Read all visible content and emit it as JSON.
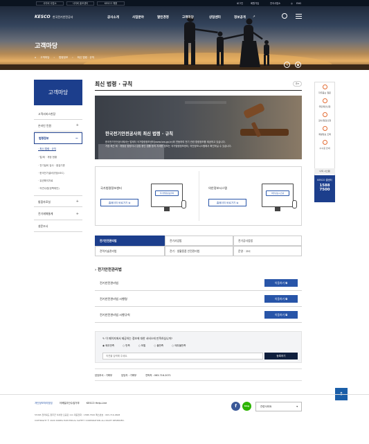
{
  "topbar": {
    "tabs": [
      "사이버 사업소",
      "사이버 홍보센터",
      "KESCO 채용"
    ],
    "links": [
      "로그인",
      "회원가입",
      "전국사업소",
      "ENG"
    ]
  },
  "header": {
    "logo_text": "KESCO",
    "logo_sub": "한국전기안전공사",
    "nav": [
      "공사소개",
      "사업분야",
      "열린경영",
      "고객마당",
      "상담센터",
      "정보공개"
    ],
    "hero_title": "고객마당",
    "breadcrumb": [
      "고객마당",
      "법령정보",
      "최신 법령 · 규칙"
    ]
  },
  "sidebar": {
    "title": "고객마당",
    "items": [
      {
        "label": "고객서비스헌장",
        "plus": false
      },
      {
        "label": "온라인 민원",
        "plus": true
      },
      {
        "label": "법령정보",
        "plus": false,
        "active": true
      },
      {
        "label": "통합자료실",
        "plus": true
      },
      {
        "label": "전기재해통계",
        "plus": true
      },
      {
        "label": "설문조사",
        "plus": false
      }
    ],
    "subitems": [
      "· 최신 법령 · 규칙",
      "· 법/제 · 개정 현황",
      "· 전기설비 검사 · 점검기준",
      "· 한국전기설비규정(KEC)",
      "· 유권해석자료",
      "· 의견수렴(정책제안)"
    ]
  },
  "main": {
    "title": "최신 법령 · 규칙",
    "zoom_label": "가+",
    "banner_title": "한국전기안전공사의 최신 법령 · 규칙",
    "banner_desc1": "한국전기안전공사에서는 법제처 국가법령정보센터(www.law.go.kr)와 연동하여 전기 관련 법령정보를 제공하고 있습니다.",
    "banner_desc2": "가장 최근 제 · 개정된 법령이나 입법 중인 법률 등의 자세한 정보는 국가법령정보센터, 의안정보시스템에서 확인하실 수 있습니다.",
    "link1_title": "국가법령정보센터",
    "link1_btn": "홈페이지 바로가기",
    "link1_screen": "국가법령정보센터",
    "link2_title": "의안정보시스템",
    "link2_btn": "홈페이지 바로가기",
    "link2_screen": "의안정보시스템",
    "categories": [
      "전기안전관리법",
      "전기사업법",
      "전기공사업법",
      "전력기술관리법",
      "전기 · 생활용품 안전관리법",
      "운영 · 고시"
    ],
    "section_title": "전기안전관리법",
    "laws": [
      {
        "name": "전기안전관리법",
        "btn": "이동하기"
      },
      {
        "name": "전기안전관리법 시행령",
        "btn": "이동하기"
      },
      {
        "name": "전기안전관리법 시행규칙",
        "btn": "이동하기"
      }
    ],
    "survey_question": "이 페이지에서 제공하는 정보에 대한 서비스에 만족하십니까?",
    "survey_options": [
      "매우만족",
      "만족",
      "보통",
      "불만족",
      "매우불만족"
    ],
    "survey_placeholder": "의견을 입력해 주세요.",
    "survey_submit": "등록하기",
    "contact_dept": "담당부서 : 기획부",
    "contact_person": "담당자 : 기획부",
    "contact_phone": "연락처 : 063-716-2071"
  },
  "quick_menu": {
    "items": [
      "자주묻는 질문",
      "국민제안신청",
      "검사/점검신청",
      "계량정보 조회",
      "수수료 안내"
    ],
    "shortcut": "나의 시스템",
    "center_label": "KESCO 콜센터",
    "phone1": "1588",
    "phone2": "7500"
  },
  "footer": {
    "links": [
      "개인정보처리방침",
      "이메일무단수집거부",
      "KESCO Help-Line"
    ],
    "address": "55365 전라북도 완주군 이서면 오공로 111   대표전화 : 1588-7500   팩스번호 : 063-716-9608",
    "copyright": "COPYRIGHT © 2020 KOREA ELECTRICAL SAFETY CORPORATION ALL RIGHT RESERVED.",
    "facebook": "f",
    "blog": "blog",
    "related_site": "관련사이트"
  },
  "colors": {
    "primary": "#1c3e8c",
    "button": "#2855a8",
    "accent": "#e36b32"
  }
}
